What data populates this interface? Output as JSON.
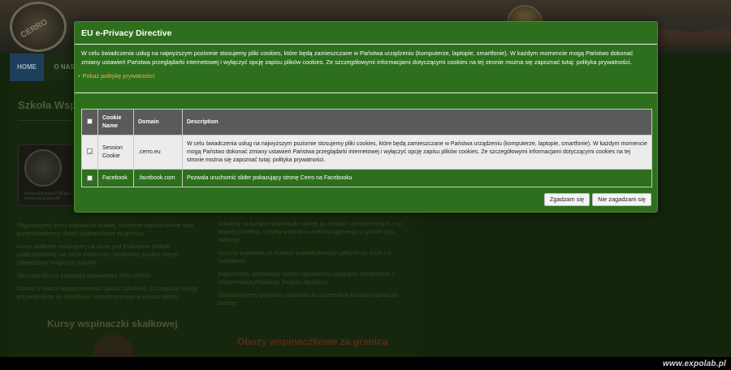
{
  "site": {
    "logo_text": "CERRO",
    "nav": {
      "home": "HOME",
      "onas": "O NAS"
    },
    "page_heading": "Szkoła Wsp",
    "instructor_card_caption": "Przewodnicząca PZA ga i wykonawca zbrodni",
    "left_column": [
      "Organizujemy kursy wspinaczki skalnej, szkolenia wspinaczkowe oraz przeprowadzamy obozy wspinaczkowe za granicą.",
      "Kursy skałkowe realizujemy na Jurze pod Krakowem (dolinki podkrakowskie), na Jurze Północnej i Środkowej, a także często odwiedzamy magiczne Sokoliki.",
      "Nasi instruktorzy posiadają uprawnienia PZA i UKFiS.",
      "Dbamy o Wasze bezpieczeństwo i jakość szkolenia. Szczególną uwagę przywiązujemy do rzetelnego i merytorycznego przekazu wiedzy."
    ],
    "right_column": [
      "Szkolimy na kursach wspinaczki skalnej po drogach ubezpieczonych i na własnej protekcji, uczymy wspinania wielowyciągowego w górach typu skalnego.",
      "Uczymy wspinania na kursach wspinaczkowych pełnych na Jurze i w Sokolikach.",
      "Zapewniamy atestowany sprzęt i sprawdzone programy szkoleniowe z rekomendacją Polskiego Związku Alpinizmu.",
      "Dostosowujemy programy szkolenia do uczestników kursów wspinaczki skalnej."
    ],
    "section_a": "Kursy wspinaczki skałkowej",
    "section_b": "Obozy wspinaczkowe za granica",
    "watermark": "www.expolab.pl"
  },
  "modal": {
    "title": "EU e-Privacy Directive",
    "body": "W celu świadczenia usług na najwyższym poziomie stosujemy pliki cookies, które będą zamieszczane w Państwa urządzeniu (komputerze, laptopie, smartfonie). W każdym momencie mogą Państwo dokonać zmiany ustawień Państwa przeglądarki internetowej i wyłączyć opcję zapisu plików cookies. Ze szczegółowymi informacjami dotyczącymi cookies na tej stronie można się zapoznać tutaj: polityka prywatności.",
    "privacy_link": "Pokaż politykę prywatności",
    "table": {
      "headers": {
        "name": "Cookie Name",
        "domain": "Domain",
        "description": "Description"
      },
      "rows": [
        {
          "checked": true,
          "name": "Session Cookie",
          "domain": ".cerro.eu",
          "description": "W celu świadczenia usług na najwyższym poziomie stosujemy pliki cookies, które będą zamieszczane w Państwa urządzeniu (komputerze, laptopie, smartfonie). W każdym momencie mogą Państwo dokonać zmiany ustawień Państwa przeglądarki internetowej i wyłączyć opcję zapisu plików cookies. Ze szczegółowymi informacjami dotyczącymi cookies na tej stronie można się zapoznać tutaj: polityka prywatności."
        },
        {
          "checked": false,
          "name": "Facebook",
          "domain": ".facebook.com",
          "description": "Pozwala uruchomić slider pokazujący stronę Cerro na Facebooku"
        }
      ]
    },
    "buttons": {
      "accept": "Zgadzam się",
      "reject": "Nie zagadzam się"
    }
  },
  "colors": {
    "modal_bg": "#2e6f1e",
    "link": "#f2b13a",
    "header_row": "#5a5a5a"
  }
}
